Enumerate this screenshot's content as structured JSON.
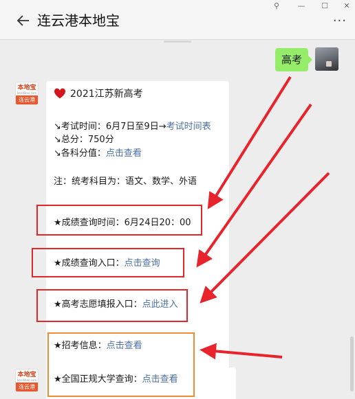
{
  "header": {
    "title": "连云港本地宝"
  },
  "window_controls": {
    "pin": "⚲",
    "minimize": "—",
    "maximize": "☐",
    "close": "✕",
    "more": "···"
  },
  "outgoing": {
    "text": "高考"
  },
  "bot_avatar": {
    "line1": "本地宝",
    "line2": "bendibao.com",
    "line3": "连云港"
  },
  "message": {
    "heading": "2021江苏新高考",
    "exam_time_prefix": "↘考试时间：6月7日至9日→",
    "exam_time_link": "考试时间表",
    "total_score": "↘总分：750分",
    "subject_score_prefix": "↘各科分值：",
    "subject_score_link": "点击查看",
    "note": "注：统考科目为：语文、数学、外语",
    "result_time": "★成绩查询时间：6月24日20：00",
    "result_entry_prefix": "★成绩查询入口：",
    "result_entry_link": "点击查询",
    "volunteer_prefix": "★高考志愿填报入口：",
    "volunteer_link": "点此进入",
    "enroll_prefix": "★招考信息：",
    "enroll_link": "点击查看",
    "university_prefix": "★全国正规大学查询：",
    "university_link": "点击查看"
  },
  "colors": {
    "highlight_box": "#e2262a",
    "highlight_box_alt": "#ef8c33",
    "arrow": "#e8232b",
    "link": "#4a6fa5",
    "bubble": "#95ec69"
  }
}
